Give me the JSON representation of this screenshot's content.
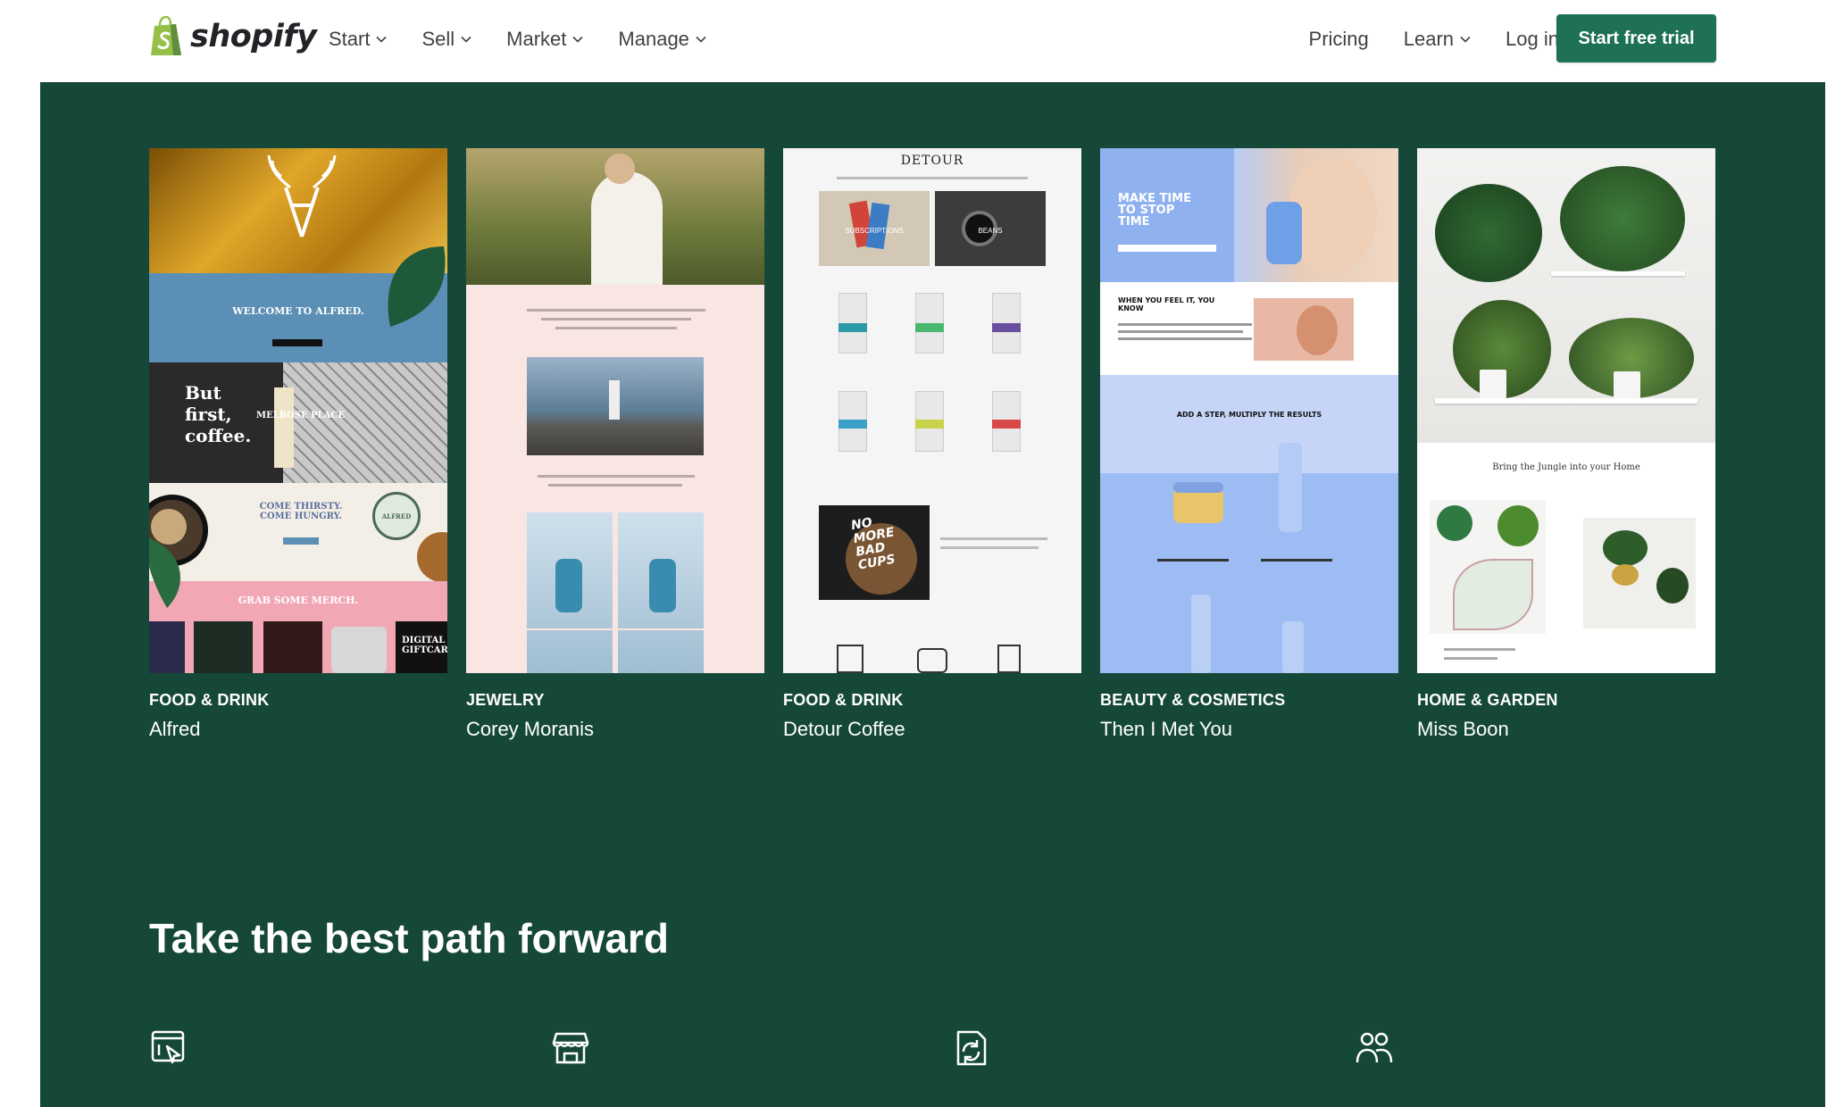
{
  "header": {
    "logo_text": "shopify",
    "nav_left": [
      {
        "label": "Start"
      },
      {
        "label": "Sell"
      },
      {
        "label": "Market"
      },
      {
        "label": "Manage"
      }
    ],
    "nav_right": [
      {
        "label": "Pricing"
      },
      {
        "label": "Learn"
      },
      {
        "label": "Log in"
      }
    ],
    "cta_label": "Start free trial"
  },
  "examples": [
    {
      "category": "FOOD & DRINK",
      "name": "Alfred",
      "thumb": {
        "hero": "WELCOME TO ALFRED.",
        "tagline_1": "But",
        "tagline_2": "first,",
        "tagline_3": "coffee.",
        "location": "MELROSE PLACE",
        "promo": "COME THIRSTY. COME HUNGRY.",
        "merch": "GRAB SOME MERCH.",
        "gift": "DIGITAL GIFTCARD",
        "seal": "ALFRED"
      }
    },
    {
      "category": "JEWELRY",
      "name": "Corey Moranis",
      "thumb": {}
    },
    {
      "category": "FOOD & DRINK",
      "name": "Detour Coffee",
      "thumb": {
        "brand": "DETOUR",
        "tile_1": "SUBSCRIPTIONS",
        "tile_2": "BEANS",
        "promo_1": "NO",
        "promo_2": "MORE",
        "promo_3": "BAD",
        "promo_4": "CUPS"
      }
    },
    {
      "category": "BEAUTY & COSMETICS",
      "name": "Then I Met You",
      "thumb": {
        "hero_1": "MAKE TIME",
        "hero_2": "TO STOP",
        "hero_3": "TIME",
        "block": "WHEN YOU FEEL IT, YOU KNOW",
        "steps": "ADD A STEP, MULTIPLY THE RESULTS"
      }
    },
    {
      "category": "HOME & GARDEN",
      "name": "Miss Boon",
      "thumb": {
        "tagline": "Bring the Jungle into your Home"
      }
    }
  ],
  "section": {
    "title": "Take the best path forward"
  },
  "features": [
    {
      "icon": "online-store-icon"
    },
    {
      "icon": "storefront-icon"
    },
    {
      "icon": "sync-icon"
    },
    {
      "icon": "people-icon"
    }
  ],
  "colors": {
    "brand_green": "#1e7154",
    "section_bg": "#154838",
    "shopify_bag": "#95bf47"
  }
}
